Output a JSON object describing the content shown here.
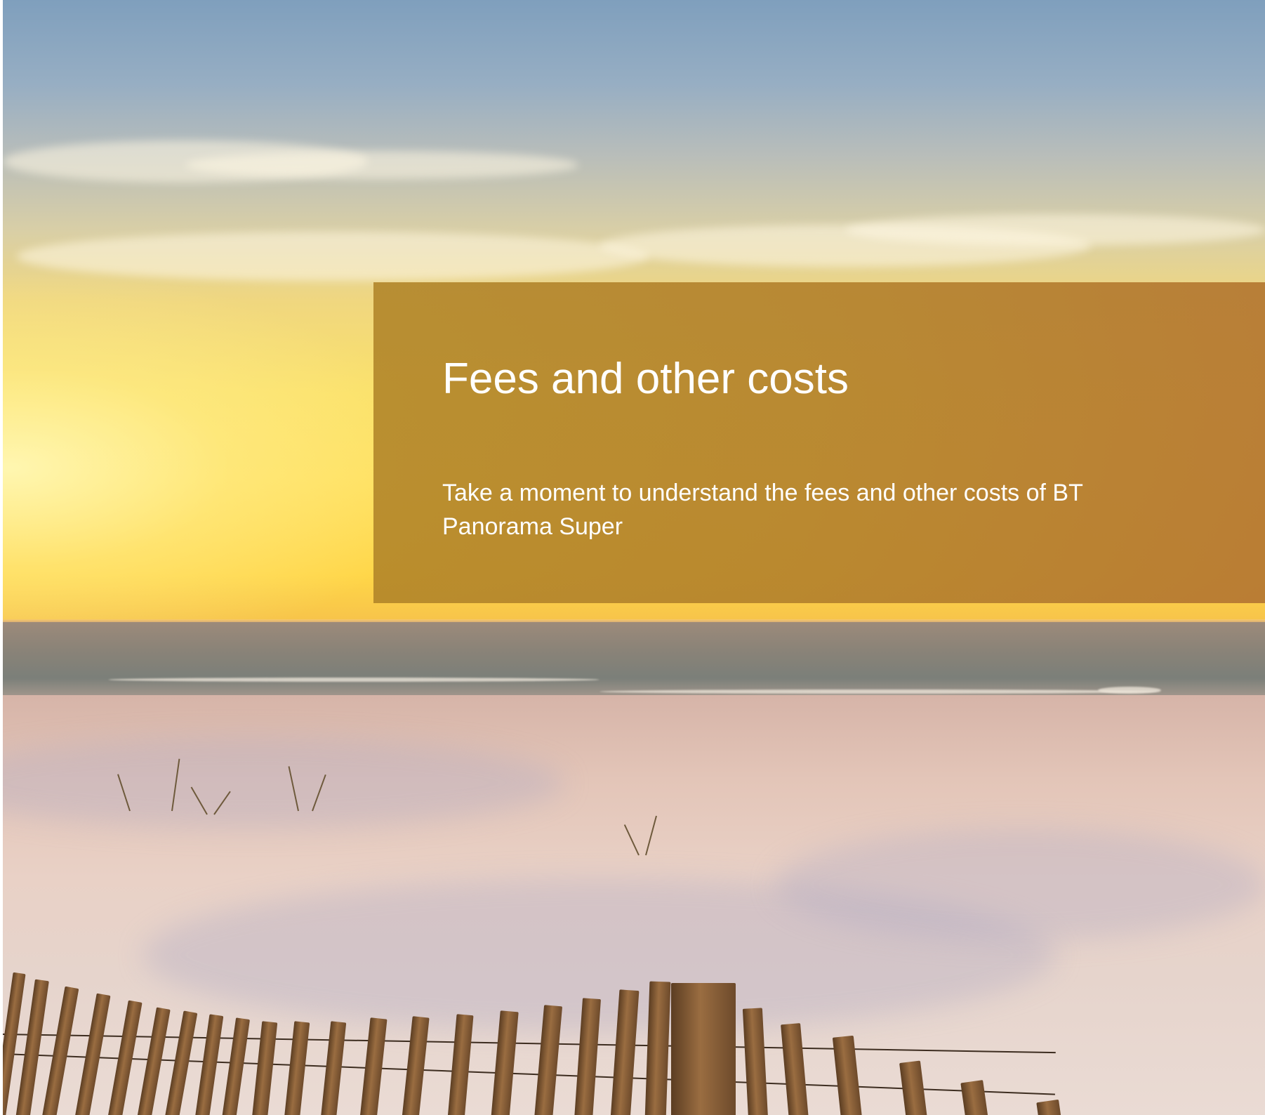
{
  "panel": {
    "title": "Fees and other costs",
    "subtitle": "Take a moment to understand the fees and other costs of BT Panorama Super"
  },
  "colors": {
    "panel_overlay": "#b08428",
    "text": "#ffffff"
  }
}
